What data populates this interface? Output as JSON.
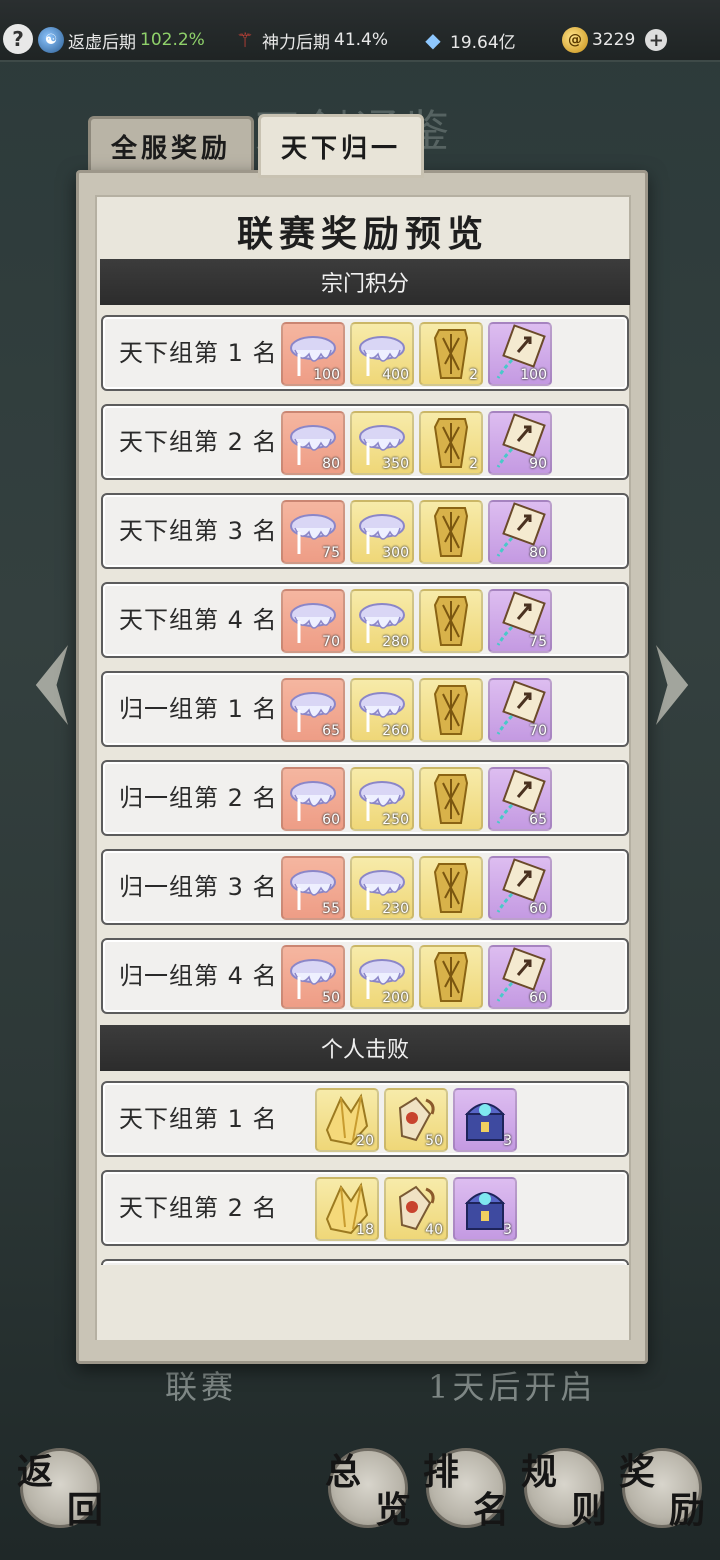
{
  "topbar": {
    "help": "?",
    "realm": {
      "label": "返虚后期",
      "pct": "102.2%"
    },
    "god": {
      "label": "神力后期",
      "pct": "41.4%"
    },
    "crystal": {
      "value": "19.64亿"
    },
    "coin": {
      "value": "3229"
    },
    "plus": "+"
  },
  "tabs": [
    {
      "label": "全服奖励",
      "active": false
    },
    {
      "label": "天下归一",
      "active": true
    }
  ],
  "panel": {
    "title": "联赛奖励预览",
    "sections": [
      {
        "title": "宗门积分"
      },
      {
        "title": "个人击败"
      }
    ],
    "sect_rows": [
      {
        "rank": "天下组第 1 名",
        "counts": [
          "100",
          "400",
          "2",
          "100"
        ]
      },
      {
        "rank": "天下组第 2 名",
        "counts": [
          "80",
          "350",
          "2",
          "90"
        ]
      },
      {
        "rank": "天下组第 3 名",
        "counts": [
          "75",
          "300",
          "",
          "80"
        ]
      },
      {
        "rank": "天下组第 4 名",
        "counts": [
          "70",
          "280",
          "",
          "75"
        ]
      },
      {
        "rank": "归一组第 1 名",
        "counts": [
          "65",
          "260",
          "",
          "70"
        ]
      },
      {
        "rank": "归一组第 2 名",
        "counts": [
          "60",
          "250",
          "",
          "65"
        ]
      },
      {
        "rank": "归一组第 3 名",
        "counts": [
          "55",
          "230",
          "",
          "60"
        ]
      },
      {
        "rank": "归一组第 4 名",
        "counts": [
          "50",
          "200",
          "",
          "60"
        ]
      }
    ],
    "personal_rows": [
      {
        "rank": "天下组第 1 名",
        "counts": [
          "20",
          "50",
          "3"
        ]
      },
      {
        "rank": "天下组第 2 名",
        "counts": [
          "18",
          "40",
          "3"
        ]
      }
    ]
  },
  "background": {
    "title": "万剑通鉴",
    "left_label": "联赛",
    "right_label": "1天后开启"
  },
  "buttons": [
    {
      "c1": "返",
      "c2": "回"
    },
    {
      "c1": "总",
      "c2": "览"
    },
    {
      "c1": "排",
      "c2": "名"
    },
    {
      "c1": "规",
      "c2": "则"
    },
    {
      "c1": "奖",
      "c2": "励"
    }
  ]
}
